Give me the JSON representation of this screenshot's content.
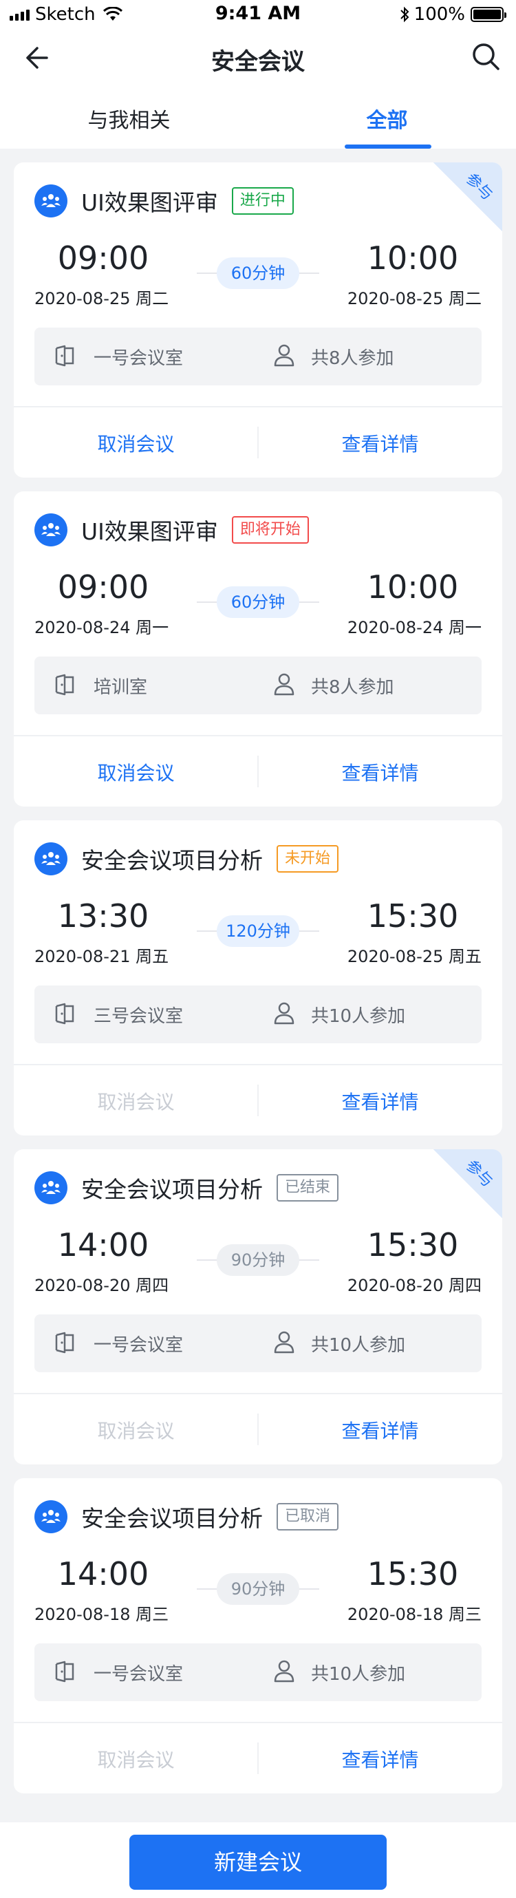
{
  "status_bar": {
    "carrier": "Sketch",
    "time": "9:41 AM",
    "battery": "100%",
    "battery_level": 1.0
  },
  "nav": {
    "title": "安全会议",
    "back_icon": "back-arrow-icon",
    "search_icon": "search-icon"
  },
  "tabs": [
    {
      "label": "与我相关",
      "selected": false
    },
    {
      "label": "全部",
      "selected": true
    }
  ],
  "colors": {
    "primary": "#1d72f3",
    "ongoing": "#19a84a",
    "soon": "#f24b4b",
    "not_started": "#f59a23",
    "muted": "#86909c"
  },
  "meetings": [
    {
      "title": "UI效果图评审",
      "status": "进行中",
      "status_color": "#19a84a",
      "corner": "参与",
      "start_time": "09:00",
      "start_date": "2020-08-25  周二",
      "duration": "60分钟",
      "end_time": "10:00",
      "end_date": "2020-08-25  周二",
      "room": "一号会议室",
      "people": "共8人参加",
      "cancel": "取消会议",
      "cancel_enabled": true,
      "detail": "查看详情"
    },
    {
      "title": "UI效果图评审",
      "status": "即将开始",
      "status_color": "#f24b4b",
      "corner": "",
      "start_time": "09:00",
      "start_date": "2020-08-24  周一",
      "duration": "60分钟",
      "end_time": "10:00",
      "end_date": "2020-08-24  周一",
      "room": "培训室",
      "people": "共8人参加",
      "cancel": "取消会议",
      "cancel_enabled": true,
      "detail": "查看详情"
    },
    {
      "title": "安全会议项目分析",
      "status": "未开始",
      "status_color": "#f59a23",
      "corner": "",
      "start_time": "13:30",
      "start_date": "2020-08-21  周五",
      "duration": "120分钟",
      "end_time": "15:30",
      "end_date": "2020-08-25  周五",
      "room": "三号会议室",
      "people": "共10人参加",
      "cancel": "取消会议",
      "cancel_enabled": false,
      "detail": "查看详情"
    },
    {
      "title": "安全会议项目分析",
      "status": "已结束",
      "status_color": "#86909c",
      "corner": "参与",
      "start_time": "14:00",
      "start_date": "2020-08-20  周四",
      "duration": "90分钟",
      "end_time": "15:30",
      "end_date": "2020-08-20  周四",
      "room": "一号会议室",
      "people": "共10人参加",
      "cancel": "取消会议",
      "cancel_enabled": false,
      "detail": "查看详情"
    },
    {
      "title": "安全会议项目分析",
      "status": "已取消",
      "status_color": "#86909c",
      "corner": "",
      "start_time": "14:00",
      "start_date": "2020-08-18  周三",
      "duration": "90分钟",
      "end_time": "15:30",
      "end_date": "2020-08-18  周三",
      "room": "一号会议室",
      "people": "共10人参加",
      "cancel": "取消会议",
      "cancel_enabled": false,
      "detail": "查看详情"
    }
  ],
  "bottom": {
    "new_button": "新建会议"
  }
}
